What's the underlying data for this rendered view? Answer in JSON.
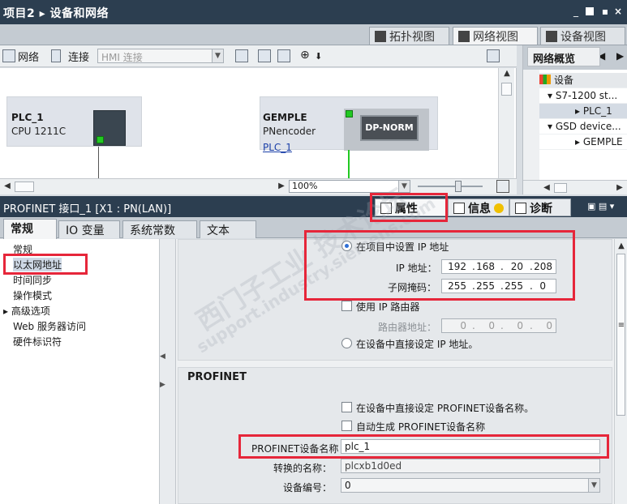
{
  "window": {
    "title_project": "项目2",
    "title_page": "设备和网络"
  },
  "view_tabs": [
    {
      "label": "拓扑视图",
      "icon": "topology-icon"
    },
    {
      "label": "网络视图",
      "icon": "network-icon",
      "active": true
    },
    {
      "label": "设备视图",
      "icon": "device-icon"
    }
  ],
  "toolbar": {
    "network_label": "网络",
    "connect_label": "连接",
    "hmi_placeholder": "HMI 连接",
    "zoom": "100%"
  },
  "canvas": {
    "devices": [
      {
        "name": "PLC_1",
        "type": "CPU 1211C"
      },
      {
        "name": "GEMPLE",
        "type": "PNencoder",
        "link": "PLC_1",
        "box_label": "DP-NORM"
      }
    ]
  },
  "overview": {
    "title": "网络概览",
    "column": "设备",
    "rows": [
      "S7-1200 st...",
      "PLC_1",
      "GSD device...",
      "GEMPLE"
    ]
  },
  "properties": {
    "title": "PROFINET 接口_1 [X1 : PN(LAN)]",
    "tabs": [
      "属性",
      "信息",
      "诊断"
    ],
    "general_tabs": [
      "常规",
      "IO 变量",
      "系统常数",
      "文本"
    ],
    "nav": [
      "常规",
      "以太网地址",
      "时间同步",
      "操作模式",
      "高级选项",
      "Web 服务器访问",
      "硬件标识符"
    ],
    "ip": {
      "set_in_project": "在项目中设置 IP 地址",
      "ip_label": "IP 地址：",
      "ip": [
        "192",
        "168",
        "20",
        "208"
      ],
      "mask_label": "子网掩码：",
      "mask": [
        "255",
        "255",
        "255",
        "0"
      ],
      "use_router": "使用 IP 路由器",
      "router_label": "路由器地址：",
      "router": [
        "0",
        "0",
        "0",
        "0"
      ],
      "set_on_device": "在设备中直接设定 IP 地址。"
    },
    "profinet": {
      "heading": "PROFINET",
      "set_name_on_device": "在设备中直接设定 PROFINET设备名称。",
      "auto_name": "自动生成 PROFINET设备名称",
      "name_label": "PROFINET设备名称",
      "name_value": "plc_1",
      "converted_label": "转换的名称：",
      "converted_value": "plcxb1d0ed",
      "device_no_label": "设备编号：",
      "device_no_value": "0"
    }
  },
  "watermark": {
    "line1": "西门子工业 技术论坛",
    "line2": "support.industry.siemens.com"
  },
  "colors": {
    "highlight": "#e6263a",
    "titlebar": "#2c3e50",
    "led": "#22c922"
  }
}
